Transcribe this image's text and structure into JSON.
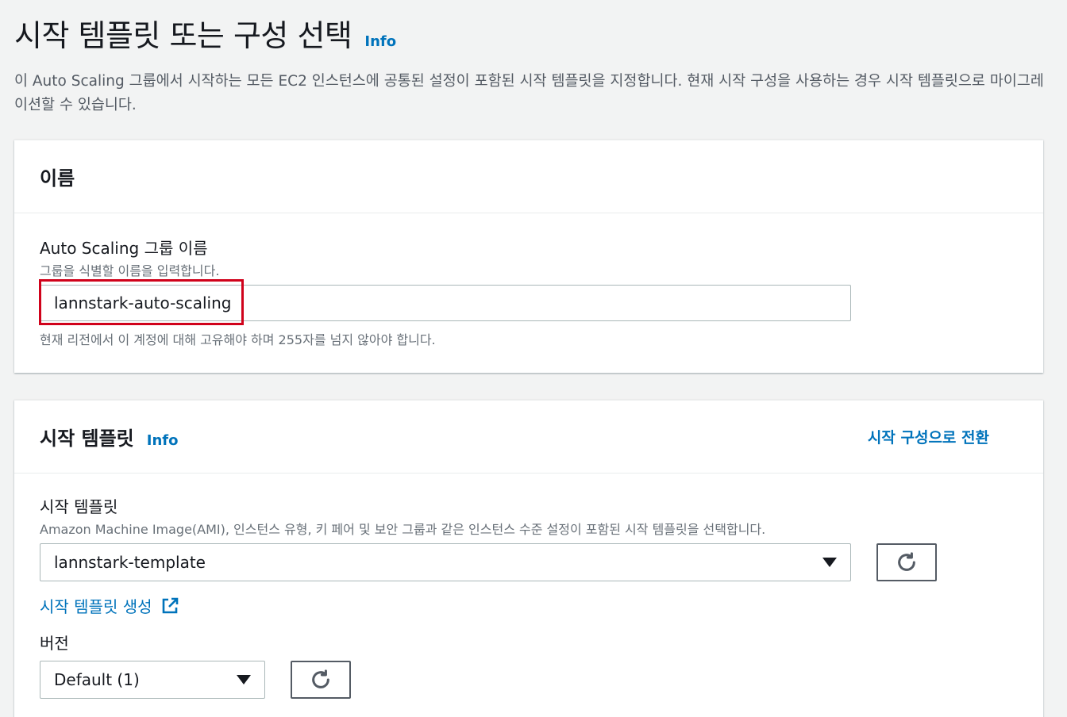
{
  "page": {
    "title": "시작 템플릿 또는 구성 선택",
    "info_label": "Info",
    "description": "이 Auto Scaling 그룹에서 시작하는 모든 EC2 인스턴스에 공통된 설정이 포함된 시작 템플릿을 지정합니다. 현재 시작 구성을 사용하는 경우 시작 템플릿으로 마이그레이션할 수 있습니다."
  },
  "name_section": {
    "heading": "이름",
    "field_label": "Auto Scaling 그룹 이름",
    "field_description": "그룹을 식별할 이름을 입력합니다.",
    "value": "lannstark-auto-scaling",
    "hint": "현재 리전에서 이 계정에 대해 고유해야 하며 255자를 넘지 않아야 합니다."
  },
  "template_section": {
    "heading": "시작 템플릿",
    "info_label": "Info",
    "switch_link": "시작 구성으로 전환",
    "field_label": "시작 템플릿",
    "field_description": "Amazon Machine Image(AMI), 인스턴스 유형, 키 페어 및 보안 그룹과 같은 인스턴스 수준 설정이 포함된 시작 템플릿을 선택합니다.",
    "selected_template": "lannstark-template",
    "create_link": "시작 템플릿 생성",
    "version_label": "버전",
    "selected_version": "Default (1)"
  },
  "colors": {
    "link": "#0073bb",
    "highlight": "#d0021b",
    "background": "#f2f3f3"
  },
  "icons": {
    "refresh": "refresh-icon",
    "external": "external-link-icon",
    "caret": "caret-down-icon"
  }
}
